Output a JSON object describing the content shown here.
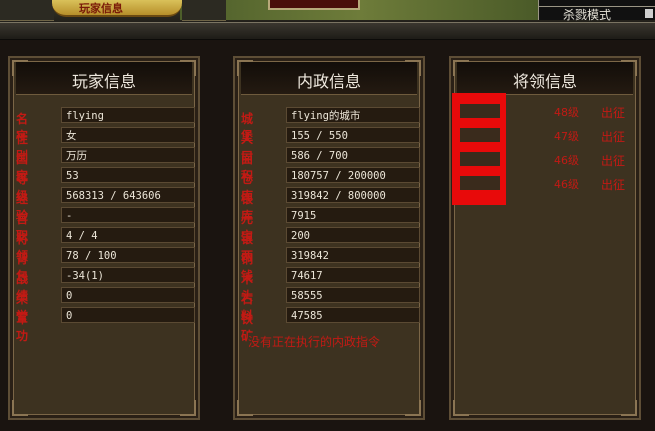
{
  "topbar": {
    "title_tab": "玩家信息",
    "mode_label": "杀戮模式"
  },
  "player_panel": {
    "title": "玩家信息",
    "rows": [
      {
        "label": "名字",
        "value": "flying"
      },
      {
        "label": "性别",
        "value": "女"
      },
      {
        "label": "国家",
        "value": "万历"
      },
      {
        "label": "等级",
        "value": "53"
      },
      {
        "label": "经验",
        "value": "568313 / 643606"
      },
      {
        "label": "官职",
        "value": "-"
      },
      {
        "label": "将领",
        "value": "4 / 4"
      },
      {
        "label": "背包",
        "value": "78 / 100"
      },
      {
        "label": "战绩",
        "value": "-34(1)"
      },
      {
        "label": "荣誉",
        "value": "0"
      },
      {
        "label": "军功",
        "value": "0"
      }
    ]
  },
  "domestic_panel": {
    "title": "内政信息",
    "rows": [
      {
        "label": "城堡",
        "value": "flying的城市"
      },
      {
        "label": "人口",
        "value": "155 / 550"
      },
      {
        "label": "面积",
        "value": "586 / 700"
      },
      {
        "label": "仓库",
        "value": "180757 / 200000"
      },
      {
        "label": "银库",
        "value": "319842 / 800000"
      },
      {
        "label": "元宝",
        "value": "7915"
      },
      {
        "label": "银两",
        "value": "200"
      },
      {
        "label": "铜钱",
        "value": "319842"
      },
      {
        "label": "木头",
        "value": "74617"
      },
      {
        "label": "石料",
        "value": "58555"
      },
      {
        "label": "铁矿",
        "value": "47585"
      }
    ],
    "status_message": "没有正在执行的内政指令"
  },
  "generals_panel": {
    "title": "将领信息",
    "generals": [
      {
        "name": "",
        "level": "48级",
        "action": "出征"
      },
      {
        "name": "",
        "level": "47级",
        "action": "出征"
      },
      {
        "name": "",
        "level": "46级",
        "action": "出征"
      },
      {
        "name": "",
        "level": "46级",
        "action": "出征"
      }
    ]
  },
  "colors": {
    "label_red": "#c21a14",
    "general_name_green": "#2ea046",
    "highlight_red": "#e80a0a",
    "panel_brown": "#3d3220"
  }
}
